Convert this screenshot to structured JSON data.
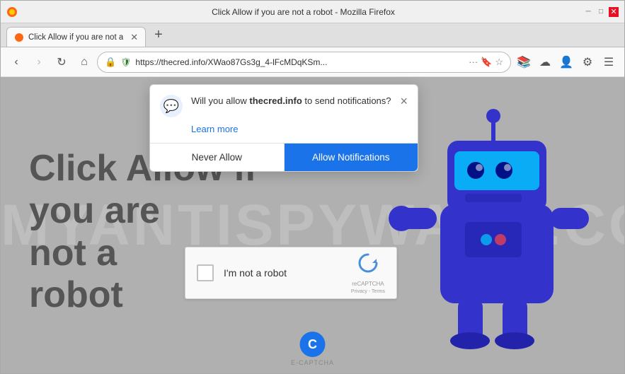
{
  "browser": {
    "title": "Click Allow if you are not a robot - Mozilla Firefox",
    "tab_label": "Click Allow if you are not a",
    "url": "https://thecred.info/XWao87Gs3g_4-lFcMDqKSm...",
    "new_tab_tooltip": "New Tab"
  },
  "nav": {
    "back": "‹",
    "forward": "›",
    "reload": "↻",
    "home": "⌂"
  },
  "window_controls": {
    "minimize": "─",
    "maximize": "□",
    "close": "✕"
  },
  "page": {
    "heading_line1": "Click Allow if",
    "heading_line2": "you are",
    "heading_line3": "not a",
    "heading_line4": "robot",
    "watermark": "MYANTISPYWARE.COM"
  },
  "notification_popup": {
    "message_prefix": "Will you allow ",
    "site_name": "thecred.info",
    "message_suffix": " to send notifications?",
    "learn_more": "Learn more",
    "never_allow": "Never Allow",
    "allow": "Allow Notifications",
    "close_icon": "×"
  },
  "recaptcha": {
    "label": "I'm not a robot",
    "brand": "reCAPTCHA",
    "privacy": "Privacy - Terms"
  },
  "ecaptcha": {
    "label": "E-CAPTCHA",
    "letter": "C"
  }
}
